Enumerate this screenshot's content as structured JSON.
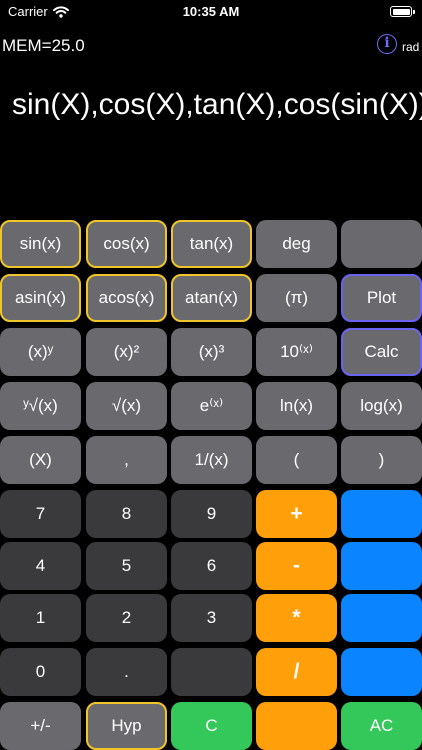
{
  "status_bar": {
    "carrier": "Carrier",
    "time": "10:35 AM"
  },
  "header": {
    "memory": "MEM=25.0",
    "info_icon": "info-icon",
    "mode": "rad"
  },
  "display": {
    "expression": "sin(X),cos(X),tan(X),cos(sin(X))"
  },
  "keys": {
    "sin": "sin(x)",
    "cos": "cos(x)",
    "tan": "tan(x)",
    "deg": "deg",
    "blank_r0": "",
    "asin": "asin(x)",
    "acos": "acos(x)",
    "atan": "atan(x)",
    "pi": "(π)",
    "plot": "Plot",
    "pow_y": "(x)ʸ",
    "pow2": "(x)²",
    "pow3": "(x)³",
    "ten_pow": "10⁽ˣ⁾",
    "calc": "Calc",
    "yroot": "ʸ√(x)",
    "sqrt": "√(x)",
    "exp": "e⁽ˣ⁾",
    "ln": "ln(x)",
    "log": "log(x)",
    "var_x": "(X)",
    "comma": ",",
    "reciprocal": "1/(x)",
    "lparen": "(",
    "rparen": ")",
    "seven": "7",
    "eight": "8",
    "nine": "9",
    "plus": "+",
    "blank_r5": "",
    "four": "4",
    "five": "5",
    "six": "6",
    "minus": "-",
    "blank_r6": "",
    "one": "1",
    "two": "2",
    "three": "3",
    "multiply": "*",
    "blank_r7": "",
    "zero": "0",
    "dot": ".",
    "blank_r8a": "",
    "divide": "/",
    "blank_r8b": "",
    "sign": "+/-",
    "hyp": "Hyp",
    "clear": "C",
    "blank_r9": "",
    "all_clear": "AC"
  },
  "colors": {
    "function_border": "#f0c52a",
    "command_border": "#6a63f0",
    "operator": "#ff9f0a",
    "blue_key": "#0a84ff",
    "clear_key": "#34c759"
  }
}
